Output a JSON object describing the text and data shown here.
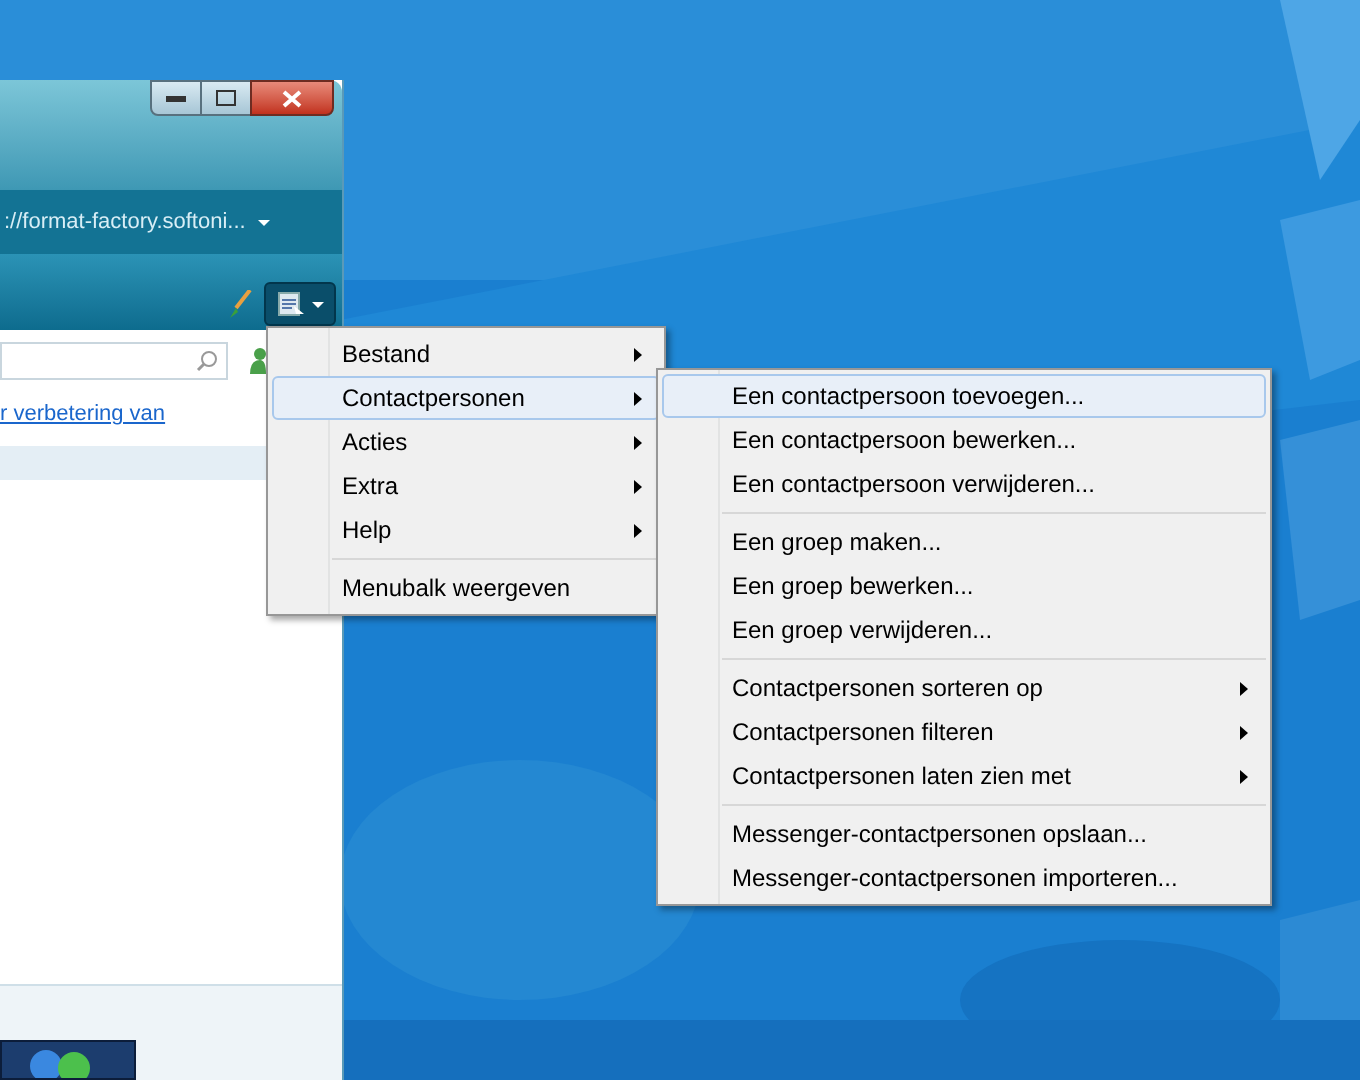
{
  "window": {
    "address": "://format-factory.softoni...",
    "link": "r verbetering van"
  },
  "menu": [
    {
      "label": "Bestand",
      "submenu": true,
      "selected": false
    },
    {
      "label": "Contactpersonen",
      "submenu": true,
      "selected": true
    },
    {
      "label": "Acties",
      "submenu": true,
      "selected": false
    },
    {
      "label": "Extra",
      "submenu": true,
      "selected": false
    },
    {
      "label": "Help",
      "submenu": true,
      "selected": false
    },
    {
      "kind": "separator"
    },
    {
      "label": "Menubalk weergeven",
      "submenu": false,
      "selected": false
    }
  ],
  "submenu": [
    {
      "label": "Een contactpersoon toevoegen...",
      "submenu": false,
      "selected": true
    },
    {
      "label": "Een contactpersoon bewerken...",
      "submenu": false,
      "selected": false
    },
    {
      "label": "Een contactpersoon verwijderen...",
      "submenu": false,
      "selected": false
    },
    {
      "kind": "separator"
    },
    {
      "label": "Een groep maken...",
      "submenu": false,
      "selected": false
    },
    {
      "label": "Een groep bewerken...",
      "submenu": false,
      "selected": false
    },
    {
      "label": "Een groep verwijderen...",
      "submenu": false,
      "selected": false
    },
    {
      "kind": "separator"
    },
    {
      "label": "Contactpersonen sorteren op",
      "submenu": true,
      "selected": false
    },
    {
      "label": "Contactpersonen filteren",
      "submenu": true,
      "selected": false
    },
    {
      "label": "Contactpersonen laten zien met",
      "submenu": true,
      "selected": false
    },
    {
      "kind": "separator"
    },
    {
      "label": "Messenger-contactpersonen opslaan...",
      "submenu": false,
      "selected": false
    },
    {
      "label": "Messenger-contactpersonen importeren...",
      "submenu": false,
      "selected": false
    }
  ]
}
